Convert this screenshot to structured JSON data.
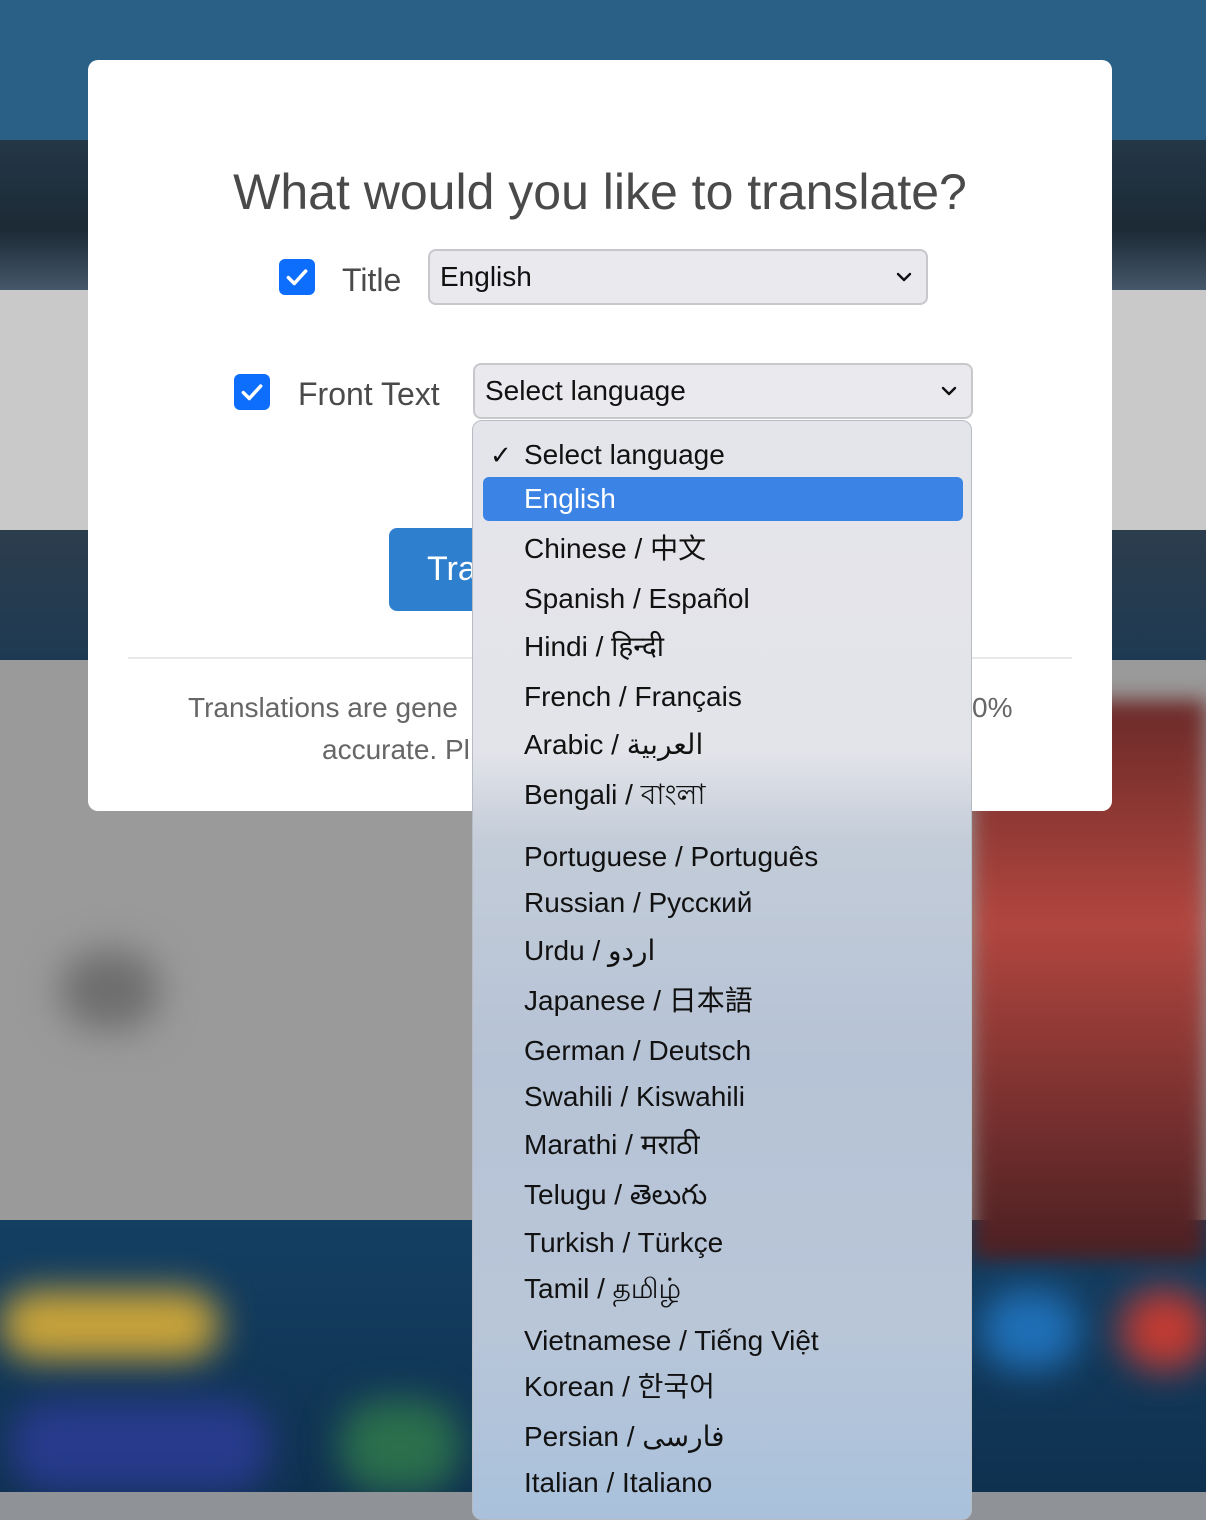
{
  "modal": {
    "title": "What would you like to translate?",
    "title_field": {
      "label": "Title",
      "selected": "English",
      "checked": true
    },
    "front_text_field": {
      "label": "Front Text",
      "selected": "Select language",
      "checked": true
    },
    "translate_button": "Tra",
    "note_line1_left": "Translations are gene",
    "note_line1_right": "0%",
    "note_line2_left": "accurate. Pl"
  },
  "dropdown": {
    "checked_option": "Select language",
    "highlighted_option": "English",
    "options": [
      "Select language",
      "English",
      "Chinese / 中文",
      "Spanish / Español",
      "Hindi / हिन्दी",
      "French / Français",
      "Arabic / العربية",
      "Bengali / বাংলা",
      "Portuguese / Português",
      "Russian / Русский",
      "Urdu / اردو",
      "Japanese / 日本語",
      "German / Deutsch",
      "Swahili / Kiswahili",
      "Marathi / मराठी",
      "Telugu / తెలుగు",
      "Turkish / Türkçe",
      "Tamil / தமிழ்",
      "Vietnamese / Tiếng Việt",
      "Korean / 한국어",
      "Persian / فارسی",
      "Italian / Italiano"
    ]
  },
  "colors": {
    "checkbox": "#0d6efd",
    "button": "#2f7fcf",
    "highlight": "#3b84e6"
  }
}
